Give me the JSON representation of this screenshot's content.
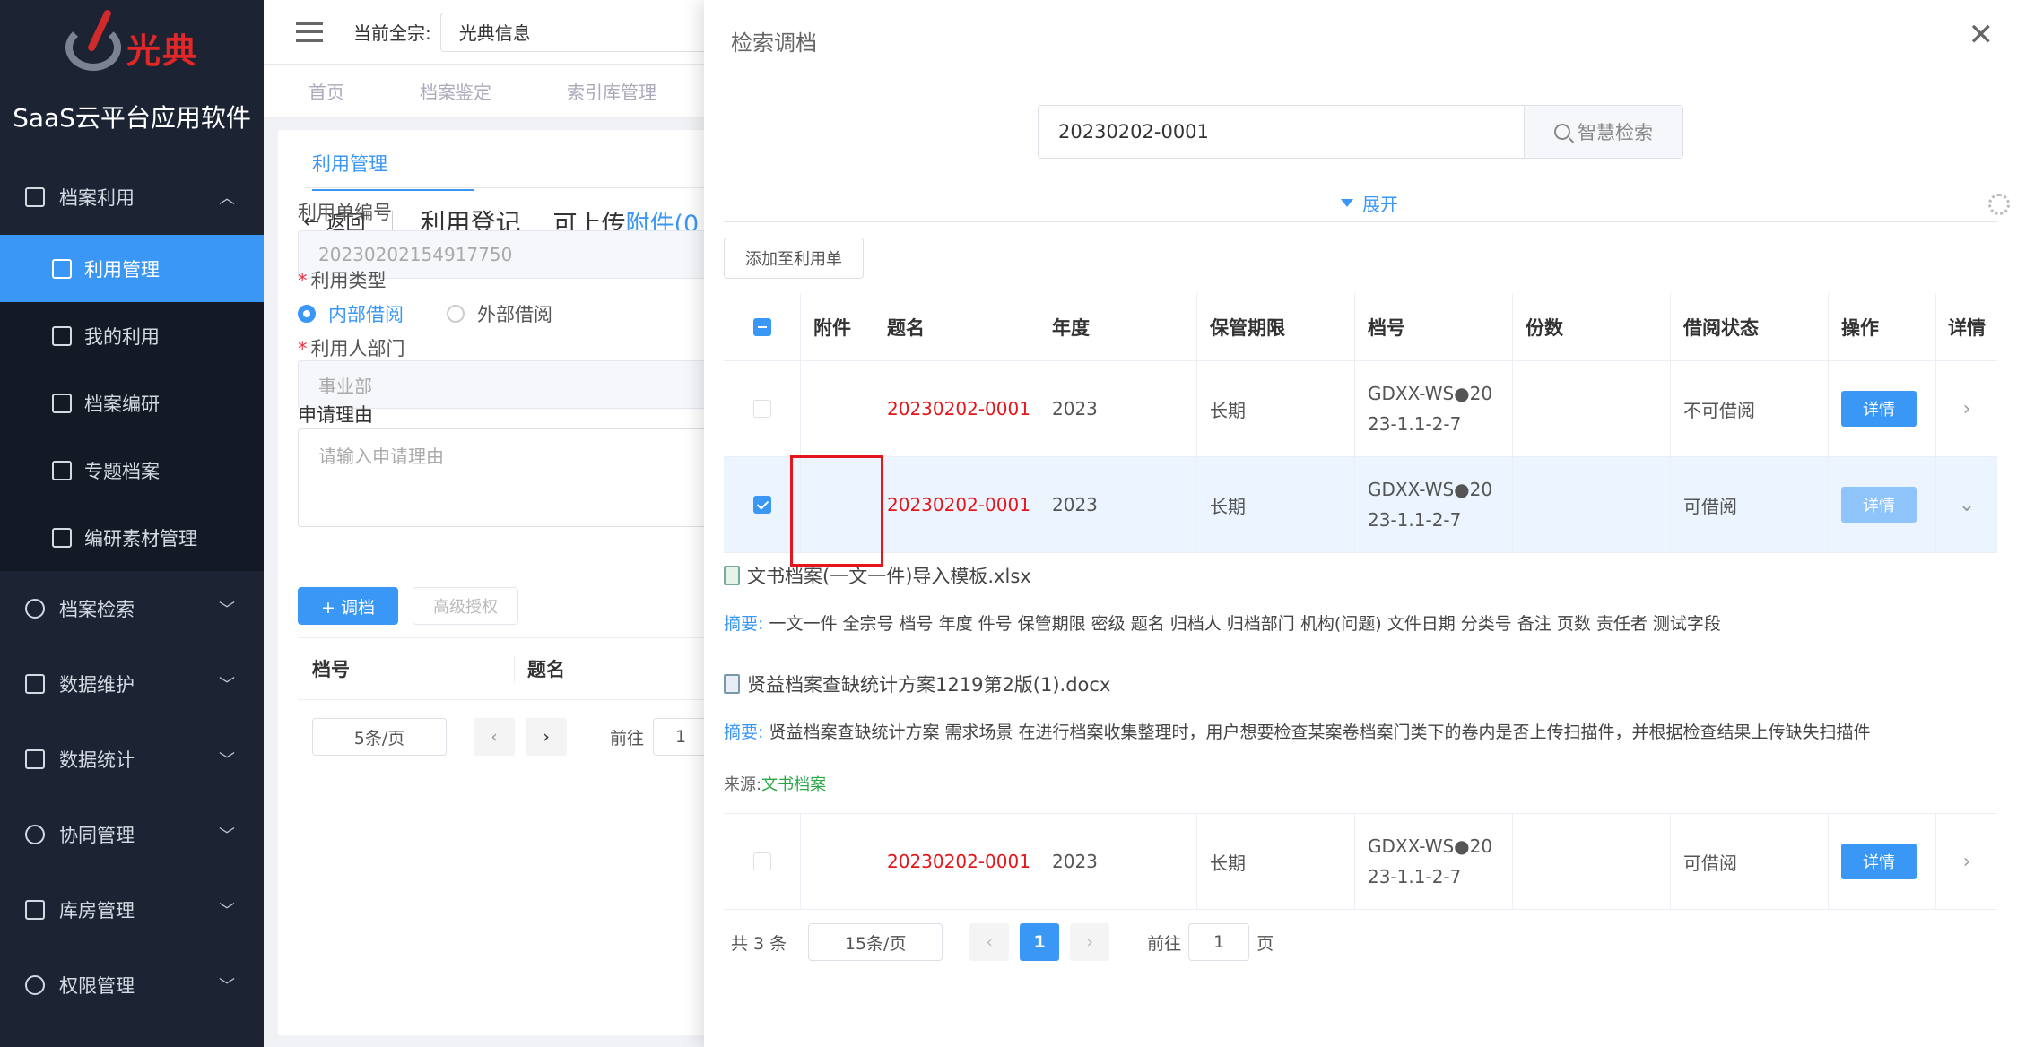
{
  "brand": {
    "logo_text": "光典",
    "app_title": "SaaS云平台应用软件"
  },
  "sidebar": {
    "group_open": {
      "label": "档案利用",
      "chevron": "chevron-up-icon"
    },
    "sub_items": [
      {
        "label": "利用管理",
        "icon": "book-icon"
      },
      {
        "label": "我的利用",
        "icon": "edit-doc-icon"
      },
      {
        "label": "档案编研",
        "icon": "list-doc-icon"
      },
      {
        "label": "专题档案",
        "icon": "folder-icon"
      },
      {
        "label": "编研素材管理",
        "icon": "save-icon"
      }
    ],
    "groups": [
      {
        "label": "档案检索",
        "icon": "search-icon"
      },
      {
        "label": "数据维护",
        "icon": "database-icon"
      },
      {
        "label": "数据统计",
        "icon": "chart-icon"
      },
      {
        "label": "协同管理",
        "icon": "users-icon"
      },
      {
        "label": "库房管理",
        "icon": "building-icon"
      },
      {
        "label": "权限管理",
        "icon": "key-icon"
      }
    ]
  },
  "topbar": {
    "current_label": "当前全宗:",
    "current_value": "光典信息"
  },
  "tabs": [
    "首页",
    "档案鉴定",
    "索引库管理"
  ],
  "form": {
    "tab": "利用管理",
    "back": "返回",
    "title": "利用登记",
    "upload_text": "可上传",
    "attach_link": "附件(0",
    "no_label": "利用单编号",
    "no_value": "20230202154917750",
    "type_label": "利用类型",
    "type_internal": "内部借阅",
    "type_external": "外部借阅",
    "dept_label": "利用人部门",
    "dept_value": "事业部",
    "reason_label": "申请理由",
    "reason_placeholder": "请输入申请理由",
    "btn_retrieve": "+ 调档",
    "btn_auth": "高级授权",
    "th_no": "档号",
    "th_title": "题名",
    "page_size": "5条/页",
    "goto": "前往",
    "page": "1"
  },
  "drawer": {
    "title": "检索调档",
    "search_value": "20230202-0001",
    "search_btn": "智慧检索",
    "expand": "展开",
    "add_btn": "添加至利用单",
    "columns": [
      "附件",
      "题名",
      "年度",
      "保管期限",
      "档号",
      "份数",
      "借阅状态",
      "操作",
      "详情"
    ],
    "rows": [
      {
        "title": "20230202-0001",
        "year": "2023",
        "period": "长期",
        "no_l1": "GDXX-WS●20",
        "no_l2": "23-1.1-2-7",
        "copies": "",
        "status": "不可借阅",
        "op": "详情",
        "checked": false
      },
      {
        "title": "20230202-0001",
        "year": "2023",
        "period": "长期",
        "no_l1": "GDXX-WS●20",
        "no_l2": "23-1.1-2-7",
        "copies": "",
        "status": "可借阅",
        "op": "详情",
        "checked": true
      },
      {
        "title": "20230202-0001",
        "year": "2023",
        "period": "长期",
        "no_l1": "GDXX-WS●20",
        "no_l2": "23-1.1-2-7",
        "copies": "",
        "status": "可借阅",
        "op": "详情",
        "checked": false
      }
    ],
    "attachments": [
      {
        "file": "文书档案(一文一件)导入模板.xlsx",
        "summary_key": "摘要:",
        "summary": " 一文一件 全宗号 档号 年度 件号 保管期限 密级 题名 归档人 归档部门 机构(问题) 文件日期 分类号 备注 页数 责任者 测试字段"
      },
      {
        "file": "贤益档案查缺统计方案1219第2版(1).docx",
        "summary_key": "摘要:",
        "summary": " 贤益档案查缺统计方案 需求场景 在进行档案收集整理时，用户想要检查某案卷档案门类下的卷内是否上传扫描件，并根据检查结果上传缺失扫描件"
      }
    ],
    "source_label": "来源:",
    "source_value": "文书档案",
    "pager": {
      "total": "共 3 条",
      "page_size": "15条/页",
      "current": "1",
      "goto": "前往",
      "page": "1",
      "page_suffix": "页"
    }
  }
}
